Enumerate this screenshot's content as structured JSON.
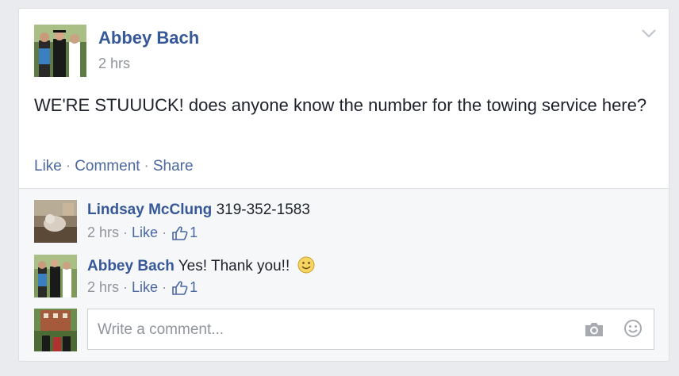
{
  "post": {
    "author": "Abbey Bach",
    "timestamp": "2 hrs",
    "text": "WE'RE STUUUCK! does anyone know the number for the towing service here?",
    "actions": {
      "like": "Like",
      "comment": "Comment",
      "share": "Share",
      "separator": "·"
    }
  },
  "comments": [
    {
      "author": "Lindsay McClung",
      "text": "319-352-1583",
      "time": "2 hrs",
      "like_label": "Like",
      "like_count": "1",
      "separator": "·"
    },
    {
      "author": "Abbey Bach",
      "text": "Yes! Thank you!!",
      "time": "2 hrs",
      "like_label": "Like",
      "like_count": "1",
      "separator": "·",
      "emoji": "smiley"
    }
  ],
  "composer": {
    "placeholder": "Write a comment..."
  },
  "icons": [
    "chevron-down-icon",
    "thumbs-up-icon",
    "smiley-icon",
    "camera-icon",
    "emoji-icon"
  ],
  "colors": {
    "link": "#365899",
    "action": "#4b67a1",
    "meta": "#90949c",
    "background": "#e9ebee",
    "comment_bg": "#f6f7f9"
  }
}
